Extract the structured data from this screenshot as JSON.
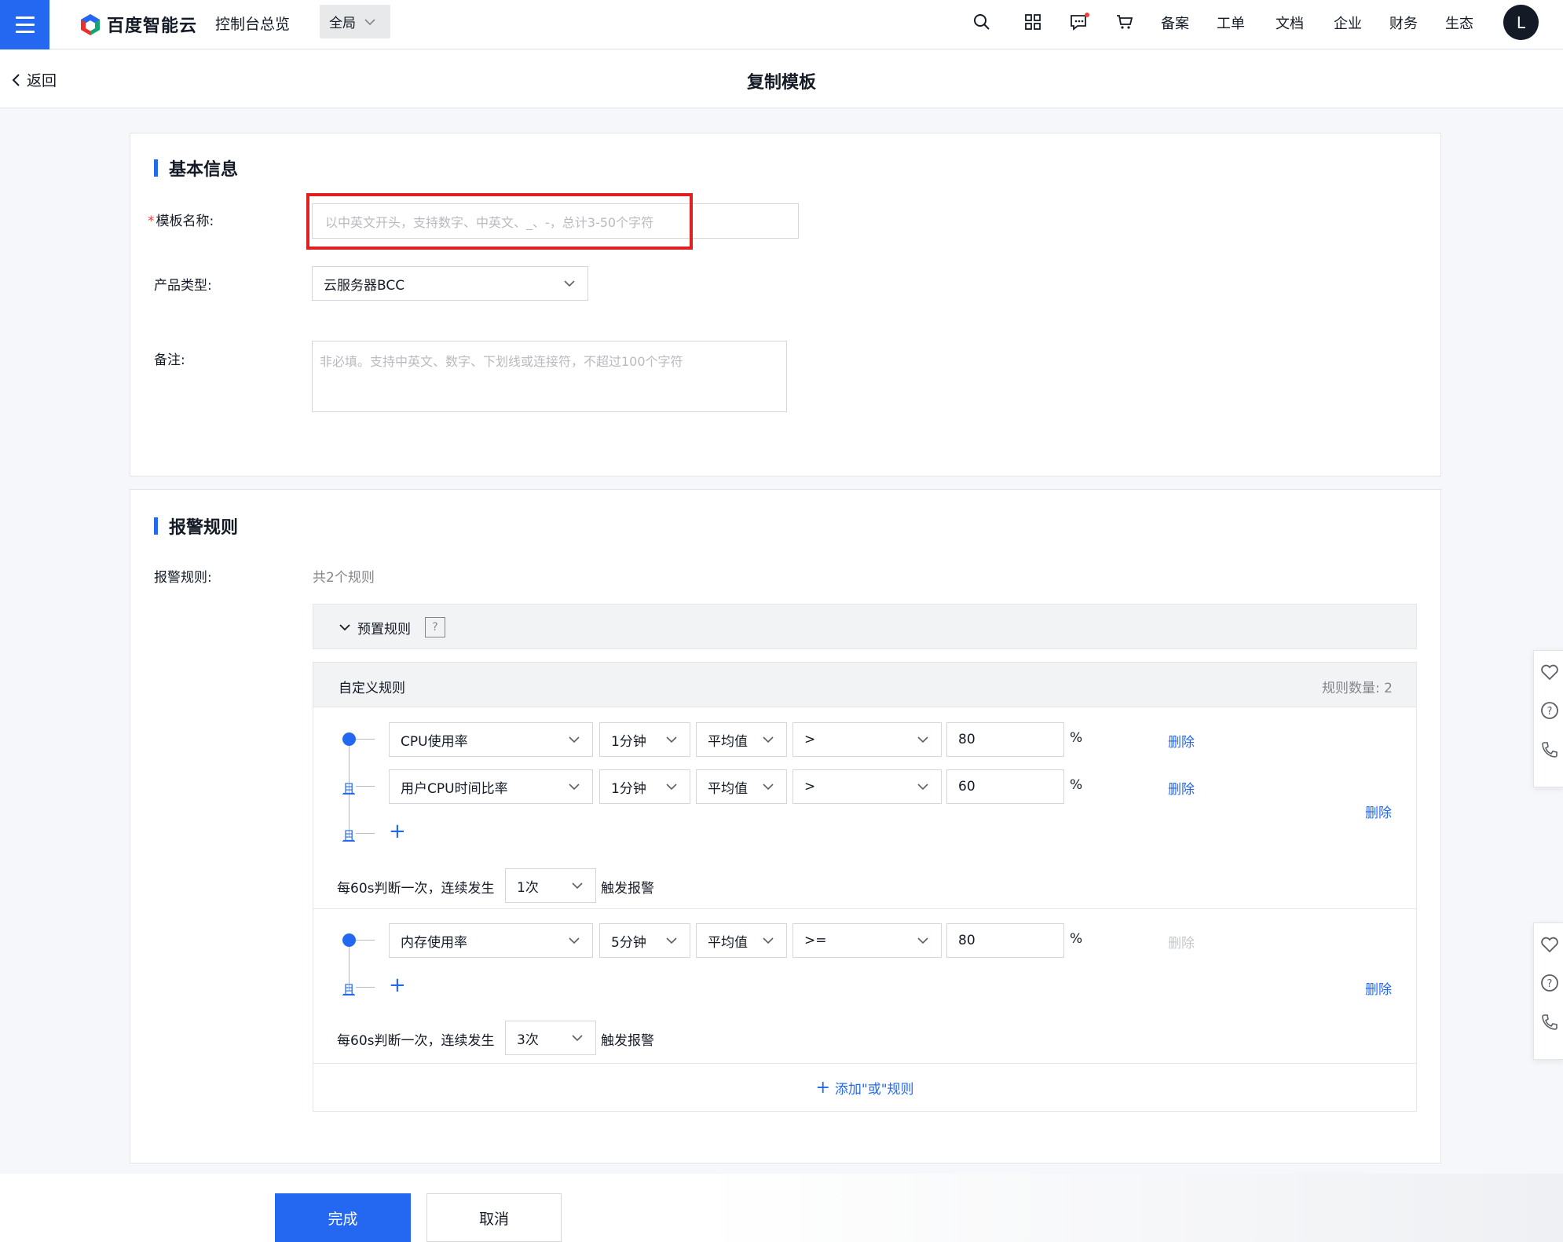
{
  "topbar": {
    "logo_text": "百度智能云",
    "console_overview": "控制台总览",
    "region": "全局",
    "links": [
      "备案",
      "工单",
      "文档",
      "企业",
      "财务",
      "生态"
    ],
    "avatar_letter": "L"
  },
  "header": {
    "back_label": "返回",
    "title": "复制模板"
  },
  "basic": {
    "section_title": "基本信息",
    "name_label": "模板名称:",
    "name_placeholder": "以中英文开头，支持数字、中英文、_、-，总计3-50个字符",
    "product_label": "产品类型:",
    "product_value": "云服务器BCC",
    "remark_label": "备注:",
    "remark_placeholder": "非必填。支持中英文、数字、下划线或连接符，不超过100个字符"
  },
  "alarm": {
    "section_title": "报警规则",
    "rules_label": "报警规则:",
    "rules_count_text": "共2个规则",
    "preset_label": "预置规则",
    "help_glyph": "?",
    "custom_label": "自定义规则",
    "rule_count_label": "规则数量: 2",
    "and_label": "且",
    "delete_label": "删除",
    "unit": "%",
    "freq_prefix": "每60s判断一次，连续发生",
    "freq_suffix": "触发报警",
    "add_or_rule": "添加\"或\"规则",
    "groups": [
      {
        "conditions": [
          {
            "metric": "CPU使用率",
            "period": "1分钟",
            "stat": "平均值",
            "op": ">",
            "value": "80"
          },
          {
            "metric": "用户CPU时间比率",
            "period": "1分钟",
            "stat": "平均值",
            "op": ">",
            "value": "60"
          }
        ],
        "times": "1次"
      },
      {
        "conditions": [
          {
            "metric": "内存使用率",
            "period": "5分钟",
            "stat": "平均值",
            "op": ">=",
            "value": "80"
          }
        ],
        "times": "3次"
      }
    ]
  },
  "footer": {
    "submit": "完成",
    "cancel": "取消"
  },
  "colors": {
    "primary": "#2468f2",
    "highlight": "#e02020",
    "danger": "#f33e3e"
  }
}
